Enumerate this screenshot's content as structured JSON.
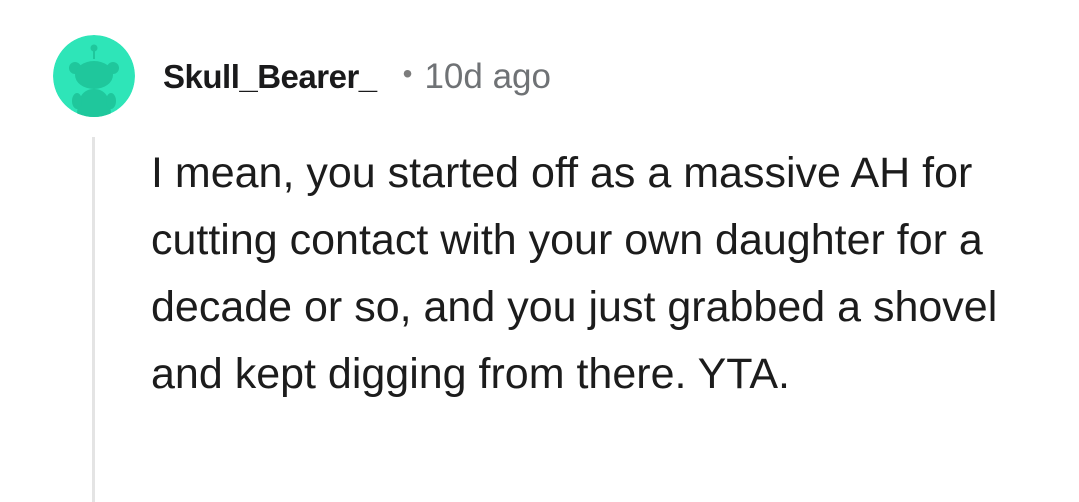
{
  "comment": {
    "username": "Skull_Bearer_",
    "separator": "•",
    "timestamp": "10d ago",
    "body": "I mean, you started off as a massive AH for cutting contact with your own daughter for a decade or so, and you just grabbed a shovel and kept digging from there. YTA."
  },
  "colors": {
    "avatar_background": "#2ee5b8",
    "thread_line": "#e4e4e4"
  }
}
